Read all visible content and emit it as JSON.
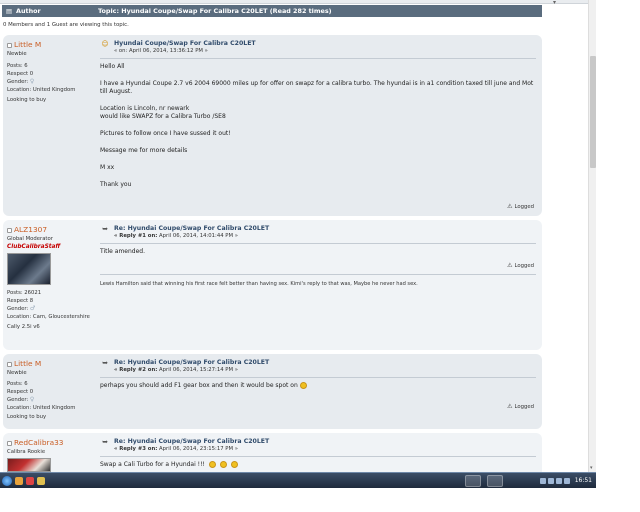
{
  "header": {
    "author_label": "Author",
    "topic_label": "Topic: Hyundai Coupe/Swap For Calibra C20LET  (Read 282 times)"
  },
  "viewing": "0 Members and 1 Guest are viewing this topic.",
  "posts": [
    {
      "author": {
        "name": "Little M",
        "rank": "Newbie",
        "posts": "Posts: 6",
        "respect": "Respect 0",
        "gender": "Gender:",
        "location": "Location: United Kingdom",
        "text": "Looking to buy"
      },
      "subject": "Hyundai Coupe/Swap For Calibra C20LET",
      "meta": "« on: April 06, 2014, 13:36:12 PM »",
      "body": [
        "Hello All",
        "I have a Hyundai Coupe 2.7 v6 2004 69000 miles up for offer on swapz for a calibra turbo. The hyundai is in a1 condition taxed till june and Mot till August.",
        "Location is Lincoln, nr newark\nwould like SWAPZ for a Calibra Turbo /SE8",
        "Pictures to follow once I have sussed it out!",
        "Message me for more details",
        "M xx",
        "Thank you"
      ],
      "logged": "Logged"
    },
    {
      "author": {
        "name": "ALZ1307",
        "rank": "Global Moderator",
        "group": "ClubCalibraStaff",
        "posts": "Posts: 26021",
        "respect": "Respect 8",
        "gender": "Gender:",
        "location": "Location: Cam, Gloucestershire",
        "text": "Cally 2.5i v6"
      },
      "subject": "Re: Hyundai Coupe/Swap For Calibra C20LET",
      "meta_prefix": "« Reply #1 on:",
      "meta": "April 06, 2014, 14:01:44 PM »",
      "body": [
        "Title amended."
      ],
      "logged": "Logged",
      "signature": "Lewis Hamilton said that winning his first race felt better than having sex. Kimi's reply to that was, Maybe he never had sex."
    },
    {
      "author": {
        "name": "Little M",
        "rank": "Newbie",
        "posts": "Posts: 6",
        "respect": "Respect 0",
        "gender": "Gender:",
        "location": "Location: United Kingdom",
        "text": "Looking to buy"
      },
      "subject": "Re: Hyundai Coupe/Swap For Calibra C20LET",
      "meta_prefix": "« Reply #2 on:",
      "meta": "April 06, 2014, 15:27:14 PM »",
      "body": [
        "perhaps you should add F1 gear box and then it would be spot on"
      ],
      "logged": "Logged"
    },
    {
      "author": {
        "name": "RedCalibra33",
        "rank": "Calibra Rookie"
      },
      "subject": "Re: Hyundai Coupe/Swap For Calibra C20LET",
      "meta_prefix": "« Reply #3 on:",
      "meta": "April 06, 2014, 23:15:17 PM »",
      "body": [
        "Swap a Cali Turbo for a Hyundai !!!"
      ]
    }
  ],
  "taskbar": {
    "clock": "16:51"
  },
  "icons": {
    "online": "status-dot-icon",
    "gender": "female-symbol-icon",
    "subject_first": "smiley-icon",
    "subject_reply": "reply-arrow-icon",
    "logged": "warning-icon"
  },
  "colors": {
    "header_bg": "#5a6c7e",
    "post_bg_odd": "#e7ebef",
    "post_bg_even": "#f0f3f6",
    "author_name": "#c95d24",
    "subject_link": "#304b6b"
  }
}
